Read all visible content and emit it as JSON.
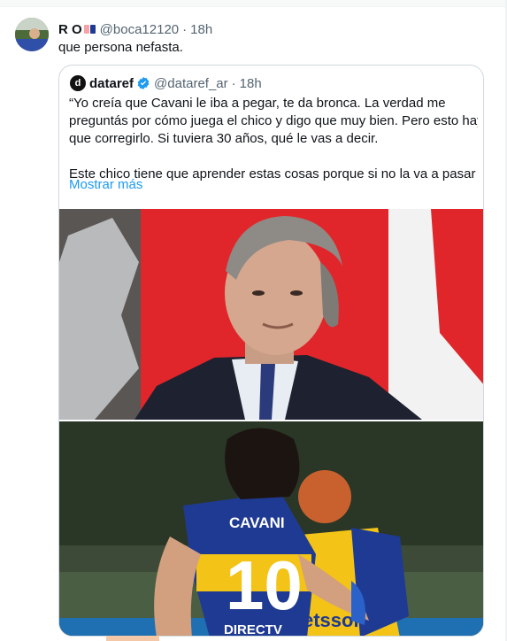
{
  "tweet": {
    "display_name": "R O",
    "handle": "@boca12120",
    "separator": "·",
    "time": "18h",
    "text": "que persona nefasta."
  },
  "quote": {
    "avatar_letter": "d",
    "display_name": "dataref",
    "handle": "@dataref_ar",
    "separator": "·",
    "time": "18h",
    "lines": [
      "“Yo creía que Cavani le iba a pegar, te da bronca. La verdad me",
      "preguntás por cómo juega el chico y digo que muy bien. Pero esto hay",
      "que corregirlo. Si tuviera 30 años, qué le vas a decir.",
      "Este chico tiene que aprender estas cosas porque si no la va a pasar …"
    ],
    "show_more": "Mostrar más"
  },
  "media": {
    "jersey_name": "CAVANI",
    "jersey_number": "10",
    "sponsor_1": "DIRECTV",
    "sponsor_2": "etsson"
  },
  "colors": {
    "link": "#1d9bf0",
    "verified": "#1d9bf0",
    "secondary_text": "#536471",
    "border": "#cfd9de",
    "boca_blue": "#1f3a93",
    "boca_yellow": "#f3c317",
    "studio_red": "#e0262b"
  },
  "icons": {
    "verified": "verified-badge-icon",
    "emoji_flag": "flag-emoji-icon"
  }
}
